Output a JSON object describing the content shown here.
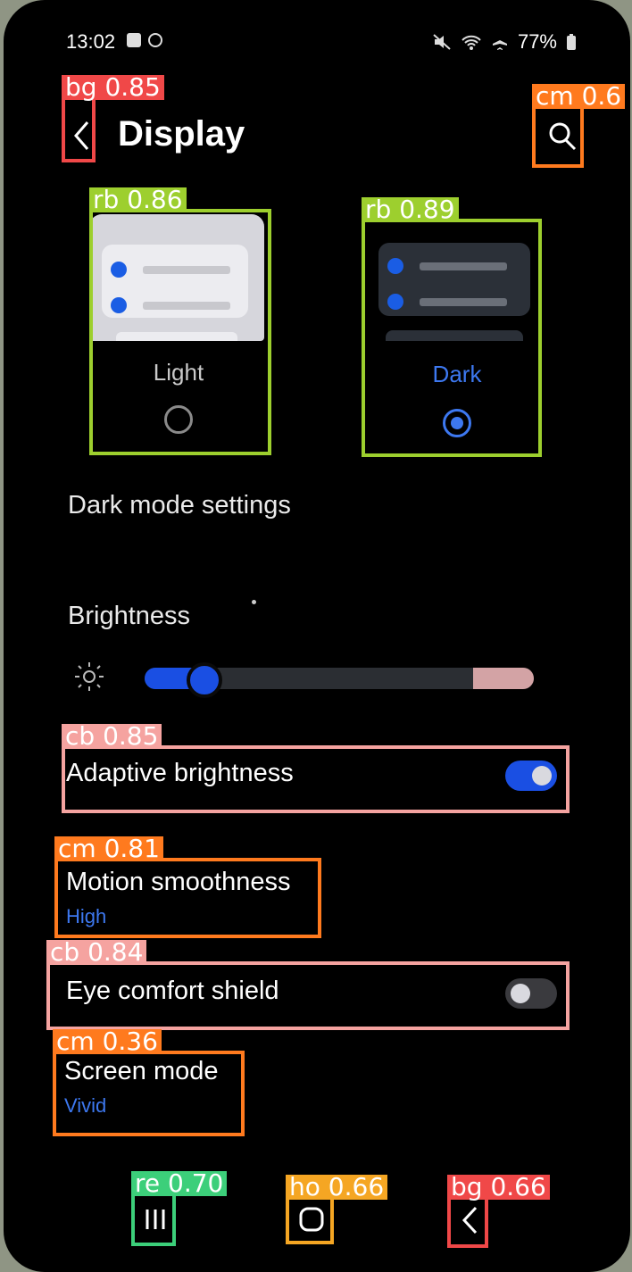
{
  "status_bar": {
    "time": "13:02",
    "battery": "77%"
  },
  "header": {
    "title": "Display"
  },
  "modes": {
    "light": {
      "label": "Light",
      "selected": false
    },
    "dark": {
      "label": "Dark",
      "selected": true
    }
  },
  "settings": {
    "dark_mode_settings": "Dark mode settings",
    "brightness": {
      "label": "Brightness",
      "level": 0.17
    },
    "adaptive_brightness": {
      "label": "Adaptive brightness",
      "enabled": true
    },
    "motion_smoothness": {
      "label": "Motion smoothness",
      "value": "High"
    },
    "eye_comfort_shield": {
      "label": "Eye comfort shield",
      "enabled": false
    },
    "screen_mode": {
      "label": "Screen mode",
      "value": "Vivid"
    }
  },
  "annotations": [
    {
      "label": "bg",
      "score": "0.85",
      "color": "#f04848"
    },
    {
      "label": "cm",
      "score": "0.6",
      "color": "#ff7a1e"
    },
    {
      "label": "rb",
      "score": "0.86",
      "color": "#9dcf2e"
    },
    {
      "label": "rb",
      "score": "0.89",
      "color": "#9dcf2e"
    },
    {
      "label": "cb",
      "score": "0.85",
      "color": "#f5a3a0"
    },
    {
      "label": "cm",
      "score": "0.81",
      "color": "#ff7a1e"
    },
    {
      "label": "cb",
      "score": "0.84",
      "color": "#f5a3a0"
    },
    {
      "label": "cm",
      "score": "0.36",
      "color": "#ff7a1e"
    },
    {
      "label": "re",
      "score": "0.70",
      "color": "#3ccf7a"
    },
    {
      "label": "ho",
      "score": "0.66",
      "color": "#f5a623"
    },
    {
      "label": "bg",
      "score": "0.66",
      "color": "#f04848"
    }
  ],
  "colors": {
    "accent": "#1a4fe3",
    "link_blue": "#3d78f0",
    "background": "#000000"
  }
}
